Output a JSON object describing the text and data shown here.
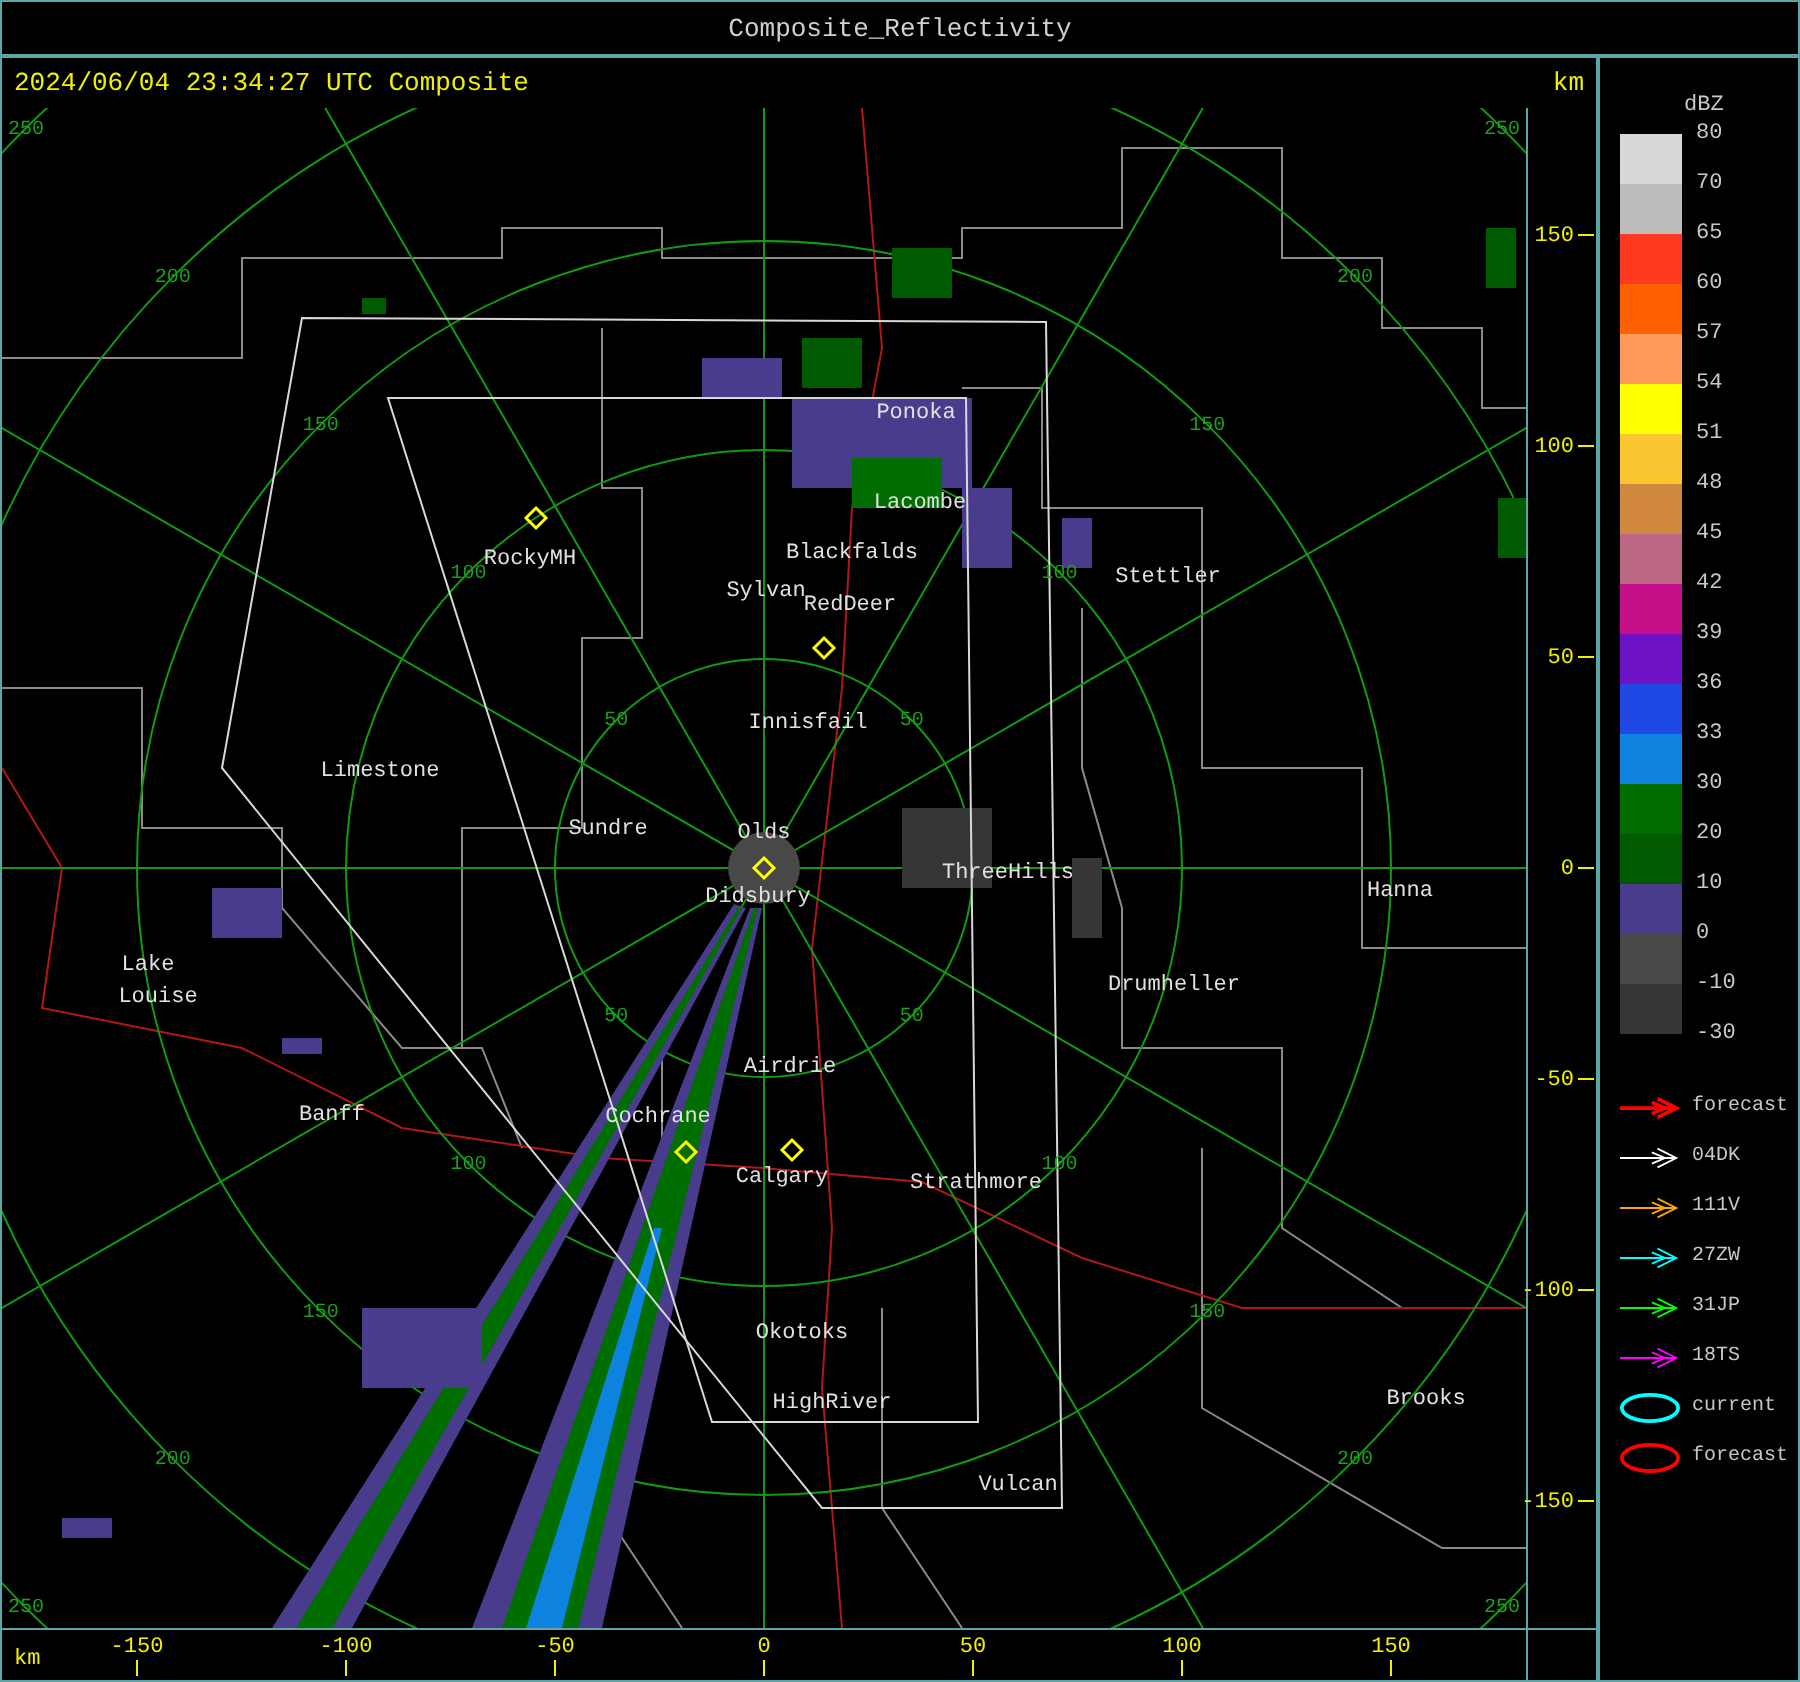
{
  "window": {
    "title": "Composite_Reflectivity"
  },
  "header": {
    "timestamp": "2024/06/04 23:34:27 UTC Composite",
    "unit": "km"
  },
  "map": {
    "range_rings": [
      {
        "labels": [
          "50",
          "50",
          "50",
          "50"
        ]
      },
      {
        "labels": [
          "100",
          "100",
          "100",
          "100"
        ]
      },
      {
        "labels": [
          "150",
          "150",
          "150",
          "150"
        ]
      },
      {
        "labels": [
          "200",
          "200",
          "200",
          "200"
        ]
      },
      {
        "labels": [
          "250",
          "250",
          "250",
          "250"
        ]
      }
    ],
    "towns": [
      "Ponoka",
      "Lacombe",
      "Blackfalds",
      "Sylvan",
      "RedDeer",
      "RockyMH",
      "Stettler",
      "Innisfail",
      "Limestone",
      "Sundre",
      "Olds",
      "Didsbury",
      "ThreeHills",
      "Hanna",
      "Drumheller",
      "Lake",
      "Louise",
      "Banff",
      "Airdrie",
      "Cochrane",
      "Calgary",
      "Strathmore",
      "Okotoks",
      "HighRiver",
      "Vulcan",
      "Brooks"
    ]
  },
  "y_axis": {
    "ticks": [
      "150",
      "100",
      "50",
      "0",
      "-50",
      "-100",
      "-150"
    ]
  },
  "x_axis": {
    "unit": "km",
    "ticks": [
      "-150",
      "-100",
      "-50",
      "0",
      "50",
      "100",
      "150"
    ]
  },
  "legend": {
    "title": "dBZ",
    "bands": [
      {
        "label": "80",
        "color": "#d8d8d8"
      },
      {
        "label": "70",
        "color": "#bcbcbc"
      },
      {
        "label": "65",
        "color": "#ff3a1e"
      },
      {
        "label": "60",
        "color": "#ff6000"
      },
      {
        "label": "57",
        "color": "#ff9a5a"
      },
      {
        "label": "54",
        "color": "#ffff00"
      },
      {
        "label": "51",
        "color": "#fbc632"
      },
      {
        "label": "48",
        "color": "#cf883e"
      },
      {
        "label": "45",
        "color": "#bd6786"
      },
      {
        "label": "42",
        "color": "#c5108a"
      },
      {
        "label": "39",
        "color": "#6e12c6"
      },
      {
        "label": "36",
        "color": "#1f48e4"
      },
      {
        "label": "33",
        "color": "#0d82de"
      },
      {
        "label": "30",
        "color": "#006e00"
      },
      {
        "label": "20",
        "color": "#005a00"
      },
      {
        "label": "10",
        "color": "#4a3c8c"
      },
      {
        "label": "0",
        "color": "#484848"
      },
      {
        "label": "-10",
        "color": "#363636"
      }
    ],
    "bottom_label": "-30",
    "items": [
      {
        "kind": "arrow",
        "label": "forecast",
        "color": "#ff0000"
      },
      {
        "kind": "arrow",
        "label": "04DK",
        "color": "#ffffff"
      },
      {
        "kind": "arrow",
        "label": "111V",
        "color": "#ffa500"
      },
      {
        "kind": "arrow",
        "label": "27ZW",
        "color": "#00ffff"
      },
      {
        "kind": "arrow",
        "label": "31JP",
        "color": "#00ff00"
      },
      {
        "kind": "arrow",
        "label": "18TS",
        "color": "#ff00ff"
      },
      {
        "kind": "ellipse",
        "label": "current",
        "color": "#00ffff"
      },
      {
        "kind": "ellipse",
        "label": "forecast",
        "color": "#ff0000"
      }
    ]
  }
}
